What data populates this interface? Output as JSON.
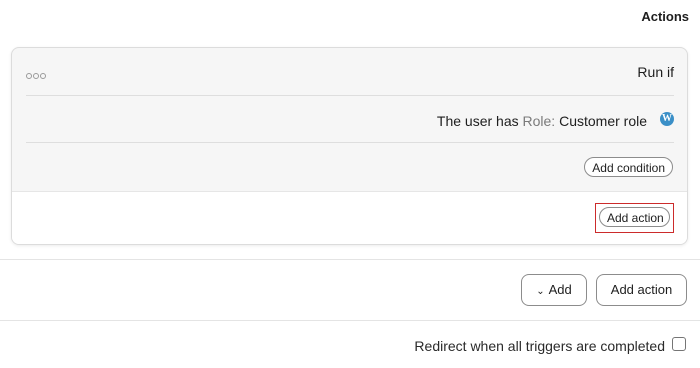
{
  "header": {
    "title": "Actions"
  },
  "trigger_card": {
    "run_if_label": "Run if",
    "condition": {
      "prefix": "The user has",
      "key": "Role:",
      "value": "Customer role",
      "icon": "wordpress-icon"
    },
    "add_condition_label": "Add condition",
    "add_action_label": "Add action"
  },
  "footer": {
    "add_label": "Add",
    "add_action_label": "Add action",
    "redirect_label": "Redirect when all triggers are completed",
    "redirect_checked": false
  }
}
